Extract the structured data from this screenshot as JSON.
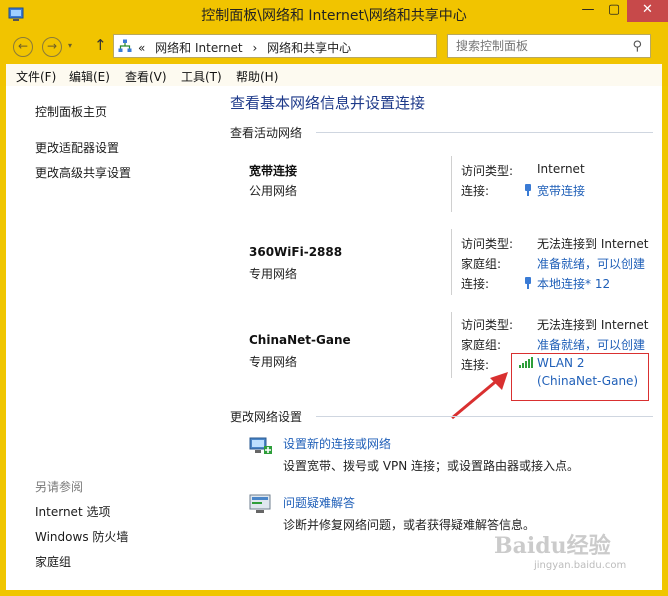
{
  "window": {
    "title": "控制面板\\网络和 Internet\\网络和共享中心",
    "minimize_glyph": "—",
    "maximize_glyph": "▢",
    "close_glyph": "✕",
    "close_color": "#c7494a",
    "frame_color": "#f1c400"
  },
  "address": {
    "back_glyph": "←",
    "forward_glyph": "→",
    "dropdown_glyph": "▾",
    "up_glyph": "↑",
    "prefix": "«",
    "crumbs": [
      "网络和 Internet",
      "›",
      "网络和共享中心"
    ],
    "chevron_glyph": "▾",
    "refresh_glyph": "↻",
    "search_placeholder": "搜索控制面板",
    "search_glyph": "⚲"
  },
  "menu": [
    "文件(F)",
    "编辑(E)",
    "查看(V)",
    "工具(T)",
    "帮助(H)"
  ],
  "sidebar": {
    "links": [
      "控制面板主页",
      "更改适配器设置",
      "更改高级共享设置"
    ],
    "see_also_heading": "另请参阅",
    "see_also": [
      "Internet 选项",
      "Windows 防火墙",
      "家庭组"
    ]
  },
  "main": {
    "title": "查看基本网络信息并设置连接",
    "active_heading": "查看活动网络",
    "networks": [
      {
        "name": "宽带连接",
        "type": "公用网络",
        "rows": [
          {
            "key": "访问类型:",
            "value": "Internet",
            "link": false
          },
          {
            "key": "连接:",
            "value": "宽带连接",
            "link": true,
            "icon": "cable-icon"
          }
        ]
      },
      {
        "name": "360WiFi-2888",
        "type": "专用网络",
        "rows": [
          {
            "key": "访问类型:",
            "value": "无法连接到 Internet",
            "link": false
          },
          {
            "key": "家庭组:",
            "value": "准备就绪，可以创建",
            "link": true
          },
          {
            "key": "连接:",
            "value": "本地连接* 12",
            "link": true,
            "icon": "cable-icon"
          }
        ]
      },
      {
        "name": "ChinaNet-Gane",
        "type": "专用网络",
        "rows": [
          {
            "key": "访问类型:",
            "value": "无法连接到 Internet",
            "link": false
          },
          {
            "key": "家庭组:",
            "value": "准备就绪，可以创建",
            "link": true
          },
          {
            "key": "连接:",
            "value": "WLAN 2",
            "value2": "(ChinaNet-Gane)",
            "link": true,
            "icon": "wifi-signal-icon"
          }
        ]
      }
    ],
    "change_heading": "更改网络设置",
    "tasks": [
      {
        "link": "设置新的连接或网络",
        "desc": "设置宽带、拨号或 VPN 连接；或设置路由器或接入点。",
        "icon": "new-connection-icon"
      },
      {
        "link": "问题疑难解答",
        "desc": "诊断并修复网络问题，或者获得疑难解答信息。",
        "icon": "troubleshoot-icon"
      }
    ]
  },
  "annotation": {
    "highlight_color": "#d93030",
    "watermark": "Baidu经验",
    "watermark_sub": "jingyan.baidu.com"
  }
}
